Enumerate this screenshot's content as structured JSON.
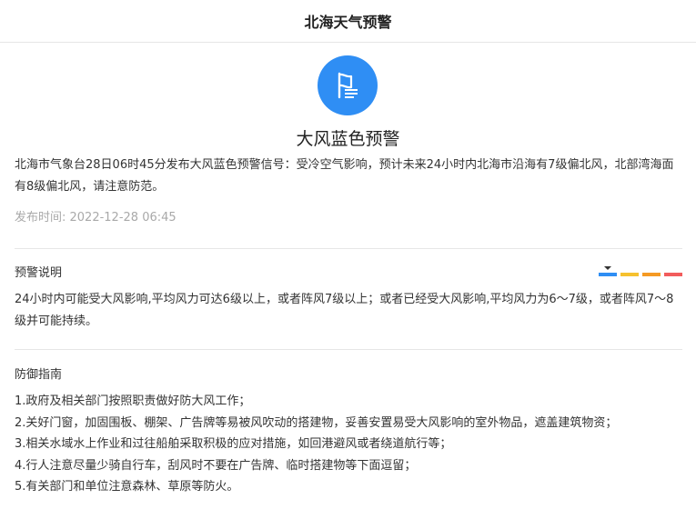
{
  "header": {
    "title": "北海天气预警"
  },
  "icon": {
    "name": "warning-flag-icon",
    "color": "#2f8ef4"
  },
  "warning": {
    "title": "大风蓝色预警",
    "notice": "北海市气象台28日06时45分发布大风蓝色预警信号：受冷空气影响，预计未来24小时内北海市沿海有7级偏北风，北部湾海面有8级偏北风，请注意防范。",
    "publish_time": "发布时间: 2022-12-28 06:45"
  },
  "explanation": {
    "title": "预警说明",
    "text": "24小时内可能受大风影响,平均风力可达6级以上，或者阵风7级以上；或者已经受大风影响,平均风力为6～7级，或者阵风7～8级并可能持续。"
  },
  "level_scale": {
    "colors": [
      "#2f8ef4",
      "#f6c12f",
      "#f59a23",
      "#f25c5c"
    ],
    "current_index": 0
  },
  "guide": {
    "title": "防御指南",
    "items": [
      "1.政府及相关部门按照职责做好防大风工作；",
      "2.关好门窗，加固围板、棚架、广告牌等易被风吹动的搭建物，妥善安置易受大风影响的室外物品，遮盖建筑物资；",
      "3.相关水域水上作业和过往船舶采取积极的应对措施，如回港避风或者绕道航行等；",
      "4.行人注意尽量少骑自行车，刮风时不要在广告牌、临时搭建物等下面逗留；",
      "5.有关部门和单位注意森林、草原等防火。"
    ]
  }
}
